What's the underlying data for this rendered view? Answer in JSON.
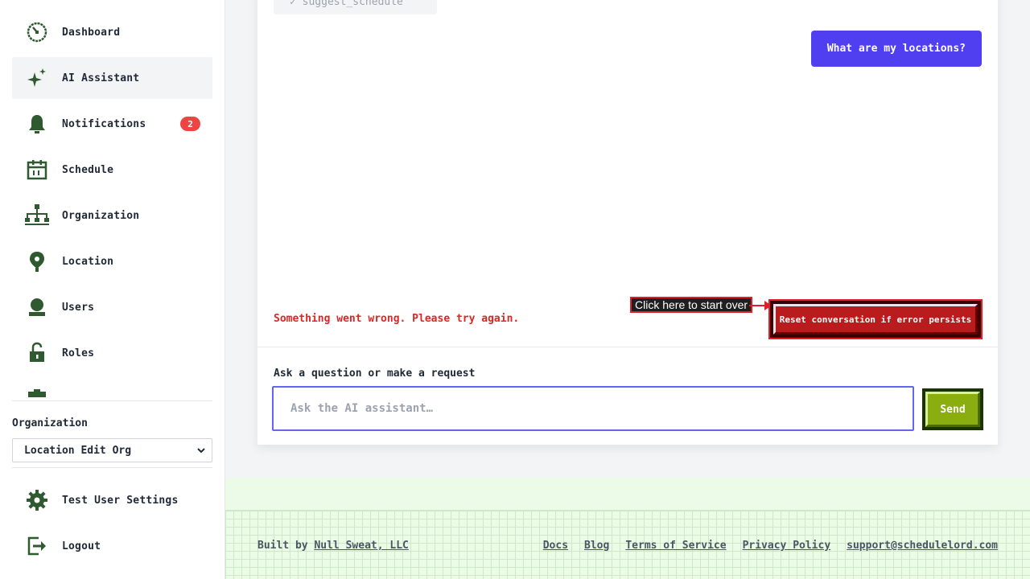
{
  "sidebar": {
    "nav_items": [
      {
        "label": "Dashboard",
        "icon": "dashboard-icon"
      },
      {
        "label": "AI Assistant",
        "icon": "sparkle-icon",
        "active": true
      },
      {
        "label": "Notifications",
        "icon": "bell-icon",
        "badge": "2"
      },
      {
        "label": "Schedule",
        "icon": "calendar-icon"
      },
      {
        "label": "Organization",
        "icon": "org-chart-icon"
      },
      {
        "label": "Location",
        "icon": "map-pin-icon"
      },
      {
        "label": "Users",
        "icon": "user-icon"
      },
      {
        "label": "Roles",
        "icon": "lock-icon"
      }
    ],
    "organization_label": "Organization",
    "organization_selected": "Location Edit Org",
    "bottom_items": [
      {
        "label": "Test User Settings",
        "icon": "gear-icon"
      },
      {
        "label": "Logout",
        "icon": "logout-icon"
      }
    ]
  },
  "chat": {
    "tool_chip": "✓ suggest_schedule",
    "user_message": "What are my locations?",
    "error_message": "Something went wrong. Please try again.",
    "annotation": "Click here to start over",
    "reset_button": "Reset conversation if error persists",
    "input_label": "Ask a question or make a request",
    "input_placeholder": "Ask the AI assistant…",
    "input_value": "",
    "send_button": "Send"
  },
  "footer": {
    "built_by_prefix": "Built by",
    "built_by_link": "Null Sweat, LLC",
    "links": [
      "Docs",
      "Blog",
      "Terms of Service",
      "Privacy Policy",
      "support@schedulelord.com"
    ]
  },
  "colors": {
    "icon_green": "#2f5a2f",
    "accent_purple": "#4f3ff0",
    "error_red": "#dc2626",
    "send_green": "#8aad0f"
  }
}
